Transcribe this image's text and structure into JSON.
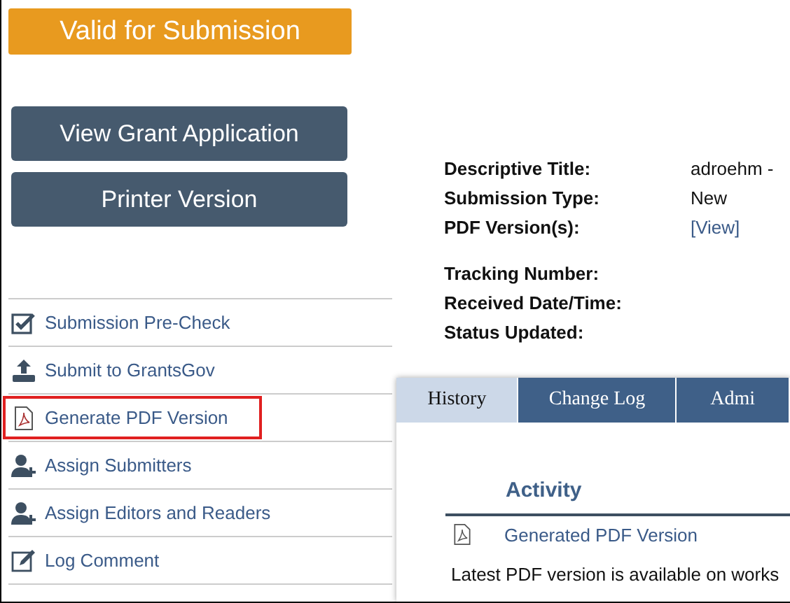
{
  "status_badge": "Valid for Submission",
  "action_buttons": [
    "View Grant Application",
    "Printer Version"
  ],
  "menu": [
    {
      "label": "Submission Pre-Check",
      "kind": "check",
      "highlighted": false
    },
    {
      "label": "Submit to GrantsGov",
      "kind": "upload",
      "highlighted": false
    },
    {
      "label": "Generate PDF Version",
      "kind": "pdf",
      "highlighted": true
    },
    {
      "label": "Assign Submitters",
      "kind": "useradd",
      "highlighted": false
    },
    {
      "label": "Assign Editors and Readers",
      "kind": "useradd",
      "highlighted": false
    },
    {
      "label": "Log Comment",
      "kind": "edit",
      "highlighted": false
    }
  ],
  "details": [
    [
      {
        "label": "Descriptive Title:",
        "value": "adroehm -",
        "kind": "text"
      },
      {
        "label": "Submission Type:",
        "value": "New",
        "kind": "text"
      },
      {
        "label": "PDF Version(s):",
        "value": "[View]",
        "kind": "link"
      }
    ],
    [
      {
        "label": "Tracking Number:"
      },
      {
        "label": "Received Date/Time:"
      },
      {
        "label": "Status Updated:"
      }
    ]
  ],
  "tabs": [
    {
      "label": "History",
      "selected": true
    },
    {
      "label": "Change Log",
      "selected": false
    },
    {
      "label": "Admi",
      "selected": false
    }
  ],
  "history": {
    "column": "Activity",
    "rows": [
      {
        "activity": "Generated PDF Version"
      }
    ],
    "note": "Latest PDF version is available on works"
  }
}
